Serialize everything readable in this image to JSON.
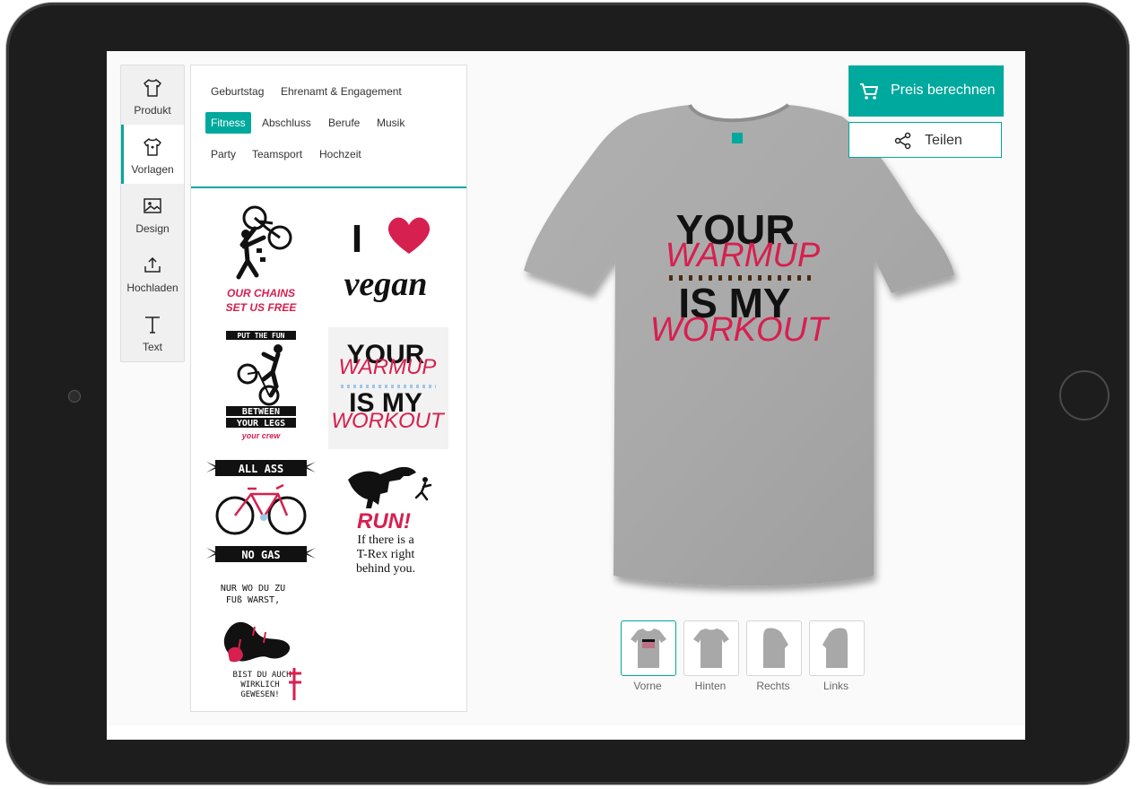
{
  "sidebar": {
    "items": [
      {
        "label": "Produkt",
        "icon": "tshirt-icon"
      },
      {
        "label": "Vorlagen",
        "icon": "tshirt-template-icon"
      },
      {
        "label": "Design",
        "icon": "image-icon"
      },
      {
        "label": "Hochladen",
        "icon": "upload-icon"
      },
      {
        "label": "Text",
        "icon": "text-icon"
      }
    ],
    "active": "Vorlagen"
  },
  "categories": [
    "Geburtstag",
    "Ehrenamt & Engagement",
    "Fitness",
    "Abschluss",
    "Berufe",
    "Musik",
    "Party",
    "Teamsport",
    "Hochzeit"
  ],
  "active_category": "Fitness",
  "templates": {
    "chains": {
      "line1": "OUR CHAINS",
      "line2": "SET US FREE"
    },
    "vegan": {
      "i": "I",
      "word": "vegan"
    },
    "warmup": {
      "l1": "YOUR",
      "l2": "WARMUP",
      "l3": "IS MY",
      "l4": "WORKOUT"
    },
    "fun": {
      "l1": "PUT THE FUN",
      "l2": "BETWEEN",
      "l3": "YOUR LEGS",
      "l4": "your crew"
    },
    "allass": {
      "top": "ALL ASS",
      "bottom": "NO GAS"
    },
    "trex": {
      "run": "RUN!",
      "l1": "If there is a",
      "l2": "T-Rex right",
      "l3": "behind you."
    },
    "fuss": {
      "l1": "NUR WO DU ZU",
      "l2": "FUß WARST,",
      "l3": "BIST DU AUCH",
      "l4": "WIRKLICH",
      "l5": "GEWESEN!"
    }
  },
  "shirt_print": {
    "l1": "YOUR",
    "l2": "WARMUP",
    "l3": "IS MY",
    "l4": "WORKOUT"
  },
  "actions": {
    "price_label": "Preis berechnen",
    "share_label": "Teilen"
  },
  "views": [
    "Vorne",
    "Hinten",
    "Rechts",
    "Links"
  ],
  "active_view": "Vorne",
  "colors": {
    "accent": "#00a99d",
    "pink": "#d6204f",
    "shirt": "#a8a8a8"
  }
}
